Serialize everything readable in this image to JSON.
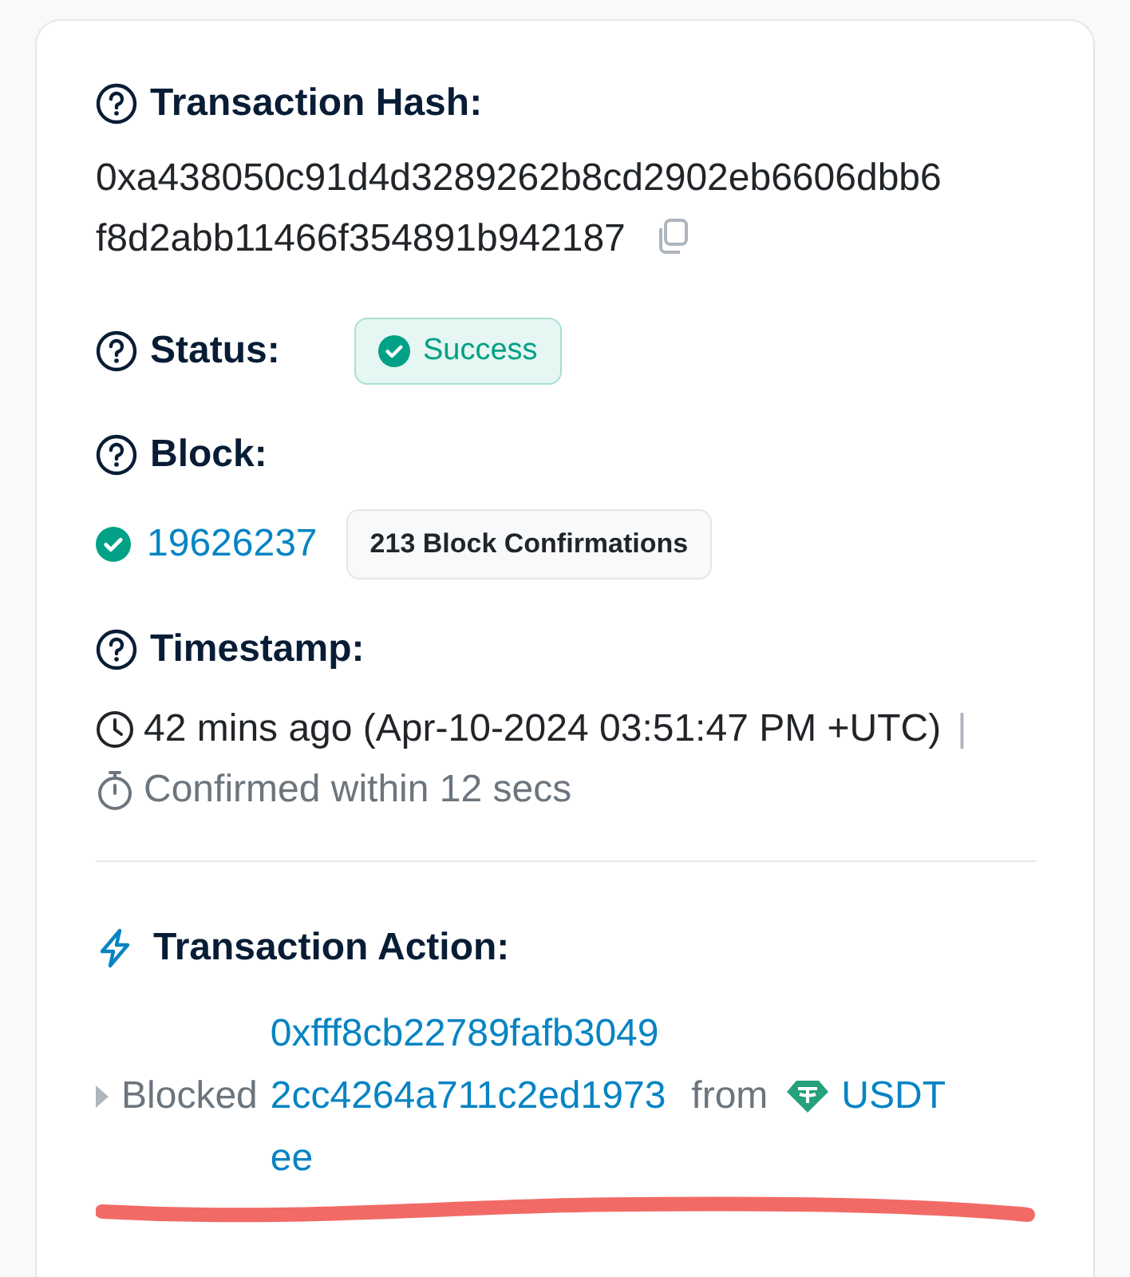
{
  "hash": {
    "label": "Transaction Hash:",
    "lines": [
      "0xa438050c91d4d3289262b8cd2902eb6606dbb6",
      "f8d2abb11466f354891b942187"
    ]
  },
  "status": {
    "label": "Status:",
    "value": "Success"
  },
  "block": {
    "label": "Block:",
    "number": "19626237",
    "confirmations": "213 Block Confirmations"
  },
  "timestamp": {
    "label": "Timestamp:",
    "time": "42 mins ago (Apr-10-2024 03:51:47 PM +UTC)",
    "separator": "|",
    "confirmed": "Confirmed within 12 secs"
  },
  "action": {
    "label": "Transaction Action:",
    "verb": "Blocked",
    "address_lines": [
      "0xfff8cb22789fafb3049",
      "2cc4264a711c2ed1973",
      "ee"
    ],
    "from": "from",
    "token": "USDT"
  }
}
